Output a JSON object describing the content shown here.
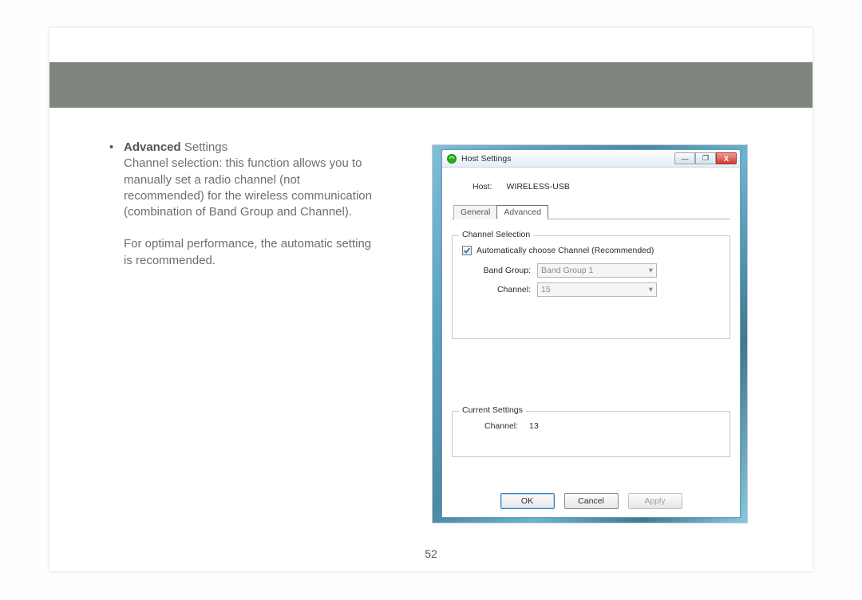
{
  "left": {
    "bullet": "•",
    "heading_bold": "Advanced",
    "heading_rest": " Settings",
    "para1": "Channel selection: this function allows you to manually set a radio channel (not recommended) for the wireless communication (combination of Band Group and Channel).",
    "para2": "For optimal performance, the automatic setting is recommended."
  },
  "page_number": "52",
  "dialog": {
    "title": "Host Settings",
    "window_buttons": {
      "min": "—",
      "max": "❐",
      "close": "X"
    },
    "host_label": "Host:",
    "host_value": "WIRELESS-USB",
    "tabs": {
      "general": "General",
      "advanced": "Advanced"
    },
    "group_channel": {
      "legend": "Channel Selection",
      "checkbox_label": "Automatically choose Channel (Recommended)",
      "band_label": "Band Group:",
      "band_value": "Band Group 1",
      "channel_label": "Channel:",
      "channel_value": "15"
    },
    "group_current": {
      "legend": "Current Settings",
      "channel_label": "Channel:",
      "channel_value": "13"
    },
    "buttons": {
      "ok": "OK",
      "cancel": "Cancel",
      "apply": "Apply"
    }
  }
}
